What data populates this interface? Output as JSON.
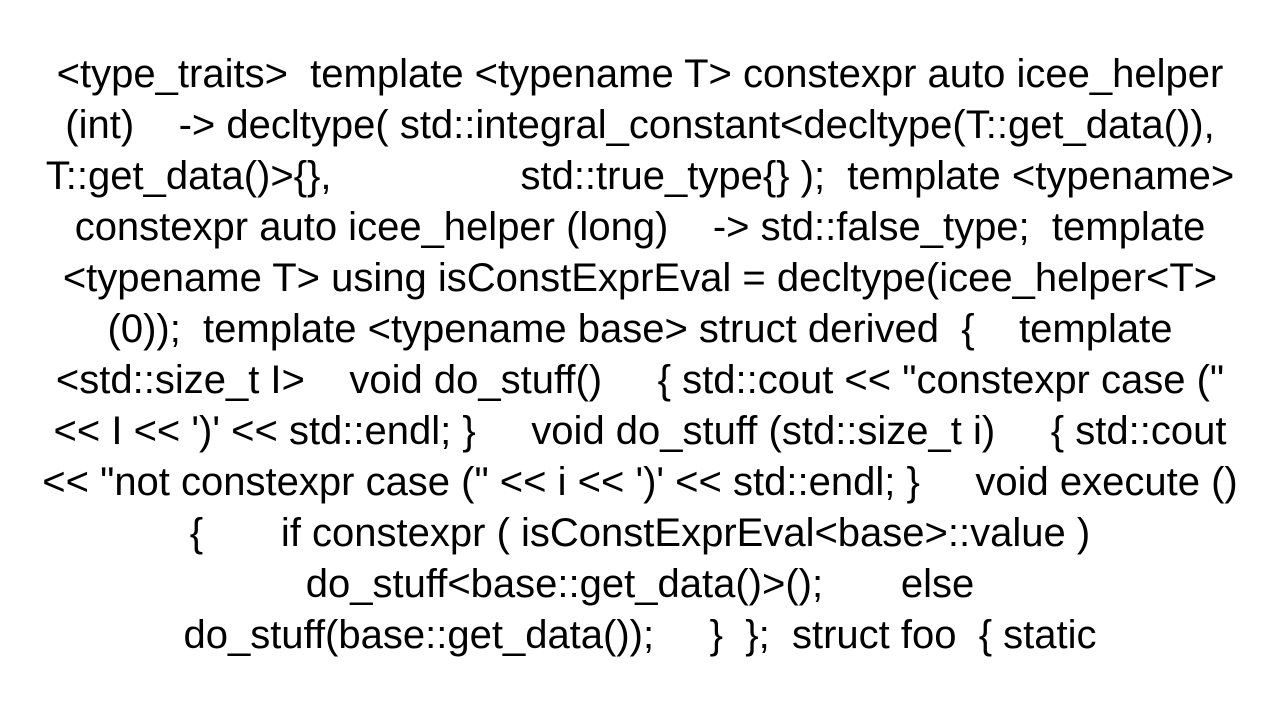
{
  "code": {
    "text": "<type_traits>  template <typename T> constexpr auto icee_helper (int)    -> decltype( std::integral_constant<decltype(T::get_data()), T::get_data()>{},                 std::true_type{} );  template <typename> constexpr auto icee_helper (long)    -> std::false_type;  template <typename T> using isConstExprEval = decltype(icee_helper<T>(0));  template <typename base> struct derived  {    template <std::size_t I>    void do_stuff()     { std::cout << \"constexpr case (\" << I << ')' << std::endl; }     void do_stuff (std::size_t i)     { std::cout << \"not constexpr case (\" << i << ')' << std::endl; }     void execute ()     {       if constexpr ( isConstExprEval<base>::value )          do_stuff<base::get_data()>();       else          do_stuff(base::get_data());     }  };  struct foo  { static"
  }
}
